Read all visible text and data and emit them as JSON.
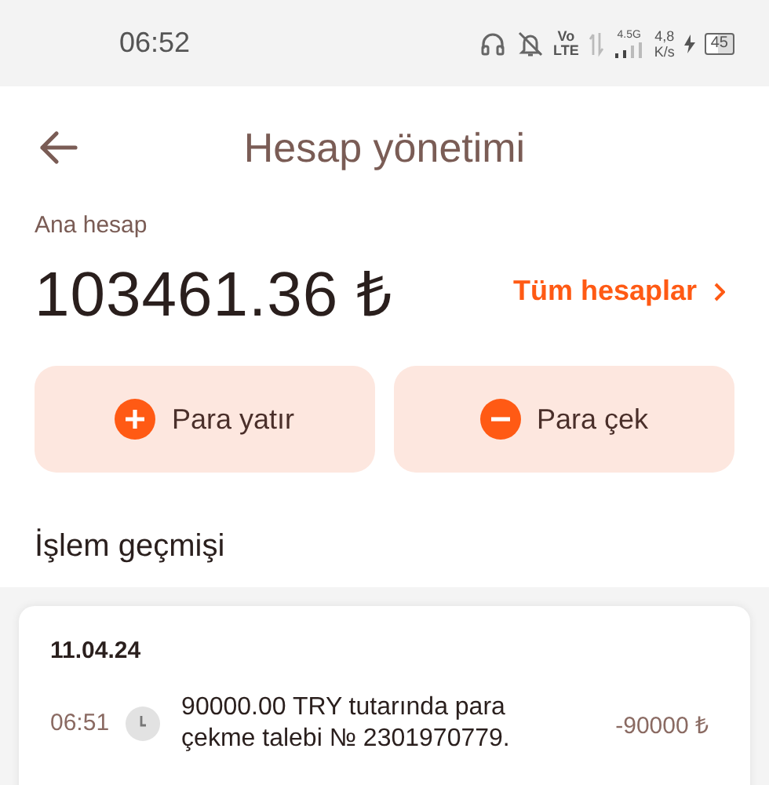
{
  "status_bar": {
    "time": "06:52",
    "volte_top": "Vo",
    "volte_bottom": "LTE",
    "network": "4.5G",
    "speed_value": "4,8",
    "speed_unit": "K/s",
    "battery": "45"
  },
  "header": {
    "title": "Hesap yönetimi"
  },
  "account": {
    "label": "Ana hesap",
    "balance": "103461.36 ₺",
    "all_accounts_link": "Tüm hesaplar"
  },
  "actions": [
    {
      "kind": "deposit",
      "label": "Para yatır"
    },
    {
      "kind": "withdraw",
      "label": "Para çek"
    }
  ],
  "history": {
    "title": "İşlem geçmişi",
    "groups": [
      {
        "date": "11.04.24",
        "transactions": [
          {
            "time": "06:51",
            "description": "90000.00 TRY tutarında para çekme talebi № 2301970779.",
            "amount": "-90000 ₺"
          }
        ]
      }
    ]
  }
}
